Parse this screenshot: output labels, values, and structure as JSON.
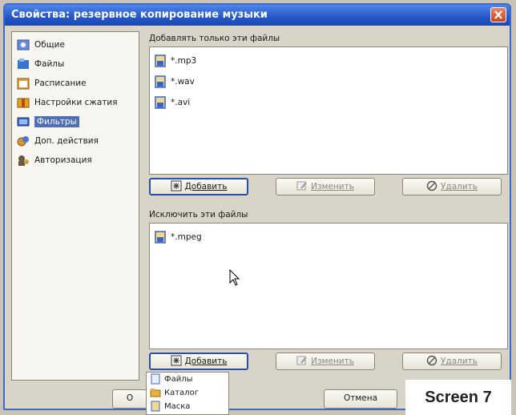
{
  "window": {
    "title": "Свойства: резервное копирование музыки"
  },
  "sidebar": {
    "items": [
      {
        "label": "Общие",
        "icon": "general-icon",
        "active": false
      },
      {
        "label": "Файлы",
        "icon": "files-icon",
        "active": false
      },
      {
        "label": "Расписание",
        "icon": "schedule-icon",
        "active": false
      },
      {
        "label": "Настройки сжатия",
        "icon": "compression-icon",
        "active": false
      },
      {
        "label": "Фильтры",
        "icon": "filters-icon",
        "active": true
      },
      {
        "label": "Доп. действия",
        "icon": "extra-actions-icon",
        "active": false
      },
      {
        "label": "Авторизация",
        "icon": "authorization-icon",
        "active": false
      }
    ]
  },
  "include": {
    "label": "Добавлять только эти файлы",
    "items": [
      "*.mp3",
      "*.wav",
      "*.avi"
    ],
    "add_label": "Добавить",
    "edit_label": "Изменить",
    "delete_label": "Удалить"
  },
  "exclude": {
    "label": "Исключить эти файлы",
    "items": [
      "*.mpeg"
    ],
    "add_label": "Добавить",
    "edit_label": "Изменить",
    "delete_label": "Удалить"
  },
  "dropdown": {
    "items": [
      "Файлы",
      "Каталог",
      "Маска"
    ]
  },
  "footer": {
    "ok_label": "О",
    "cancel_label": "Отмена"
  },
  "watermark": "Screen 7",
  "colors": {
    "titlebar": "#2456c8",
    "selection": "#4d6fb8",
    "window_bg": "#d8d4c8"
  }
}
